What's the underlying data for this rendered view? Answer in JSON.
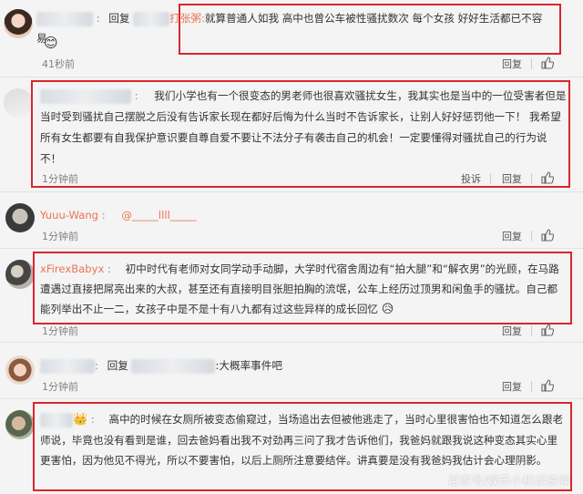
{
  "comments": [
    {
      "name": "",
      "reply_prefix": "回复",
      "reply_target_tail": "打张粥:",
      "body": "就算普通人如我 高中也曾公车被性骚扰数次 每个女孩 好好生活都已不容易",
      "time": "41秒前",
      "reply_label": "回复"
    },
    {
      "name": "",
      "body": "我们小学也有一个很变态的男老师也很喜欢骚扰女生，我其实也是当中的一位受害者但是当时受到骚扰自己摆脱之后没有告诉家长现在都好后悔为什么当时不告诉家长，让别人好好惩罚他一下！ 我希望所有女生都要有自我保护意识要自尊自爱不要让不法分子有袭击自己的机会！一定要懂得对骚扰自己的行为说不！",
      "time": "1分钟前",
      "report_label": "投诉",
      "reply_label": "回复"
    },
    {
      "name": "Yuuu-Wang",
      "body": "@_____llll_____",
      "time": "1分钟前",
      "reply_label": "回复"
    },
    {
      "name": "xFirexBabyx",
      "body": "初中时代有老师对女同学动手动脚，大学时代宿舍周边有“拍大腿”和“解衣男”的光顾，在马路遭遇过直接把屌亮出来的大叔，甚至还有直接明目张胆拍胸的流氓，公车上经历过顶男和闲鱼手的骚扰。自己都能列举出不止一二，女孩子中是不是十有八九都有过这些异样的成长回忆",
      "time": "1分钟前",
      "reply_label": "回复"
    },
    {
      "name": "",
      "reply_prefix": "回复",
      "body": ":大概率事件吧",
      "time": "1分钟前",
      "reply_label": "回复"
    },
    {
      "name": "",
      "body": "高中的时候在女厕所被变态偷窥过，当场追出去但被他逃走了，当时心里很害怕也不知道怎么跟老师说，毕竟也没有看到是谁，回去爸妈看出我不对劲再三问了我才告诉他们，我爸妈就跟我说这种变态其实心里更害怕，因为他见不得光，所以不要害怕，以后上厕所注意要结伴。讲真要是没有我爸妈我估计会心理阴影。"
    }
  ],
  "watermark": "百家号/娱乐小机谈资弹",
  "icons": [
    "thumbs-up-icon",
    "avatar-icon",
    "emoji-icon"
  ],
  "colors": {
    "highlight_border": "#d9262d",
    "username": "#eb7350",
    "background": "#f4f4f4"
  }
}
